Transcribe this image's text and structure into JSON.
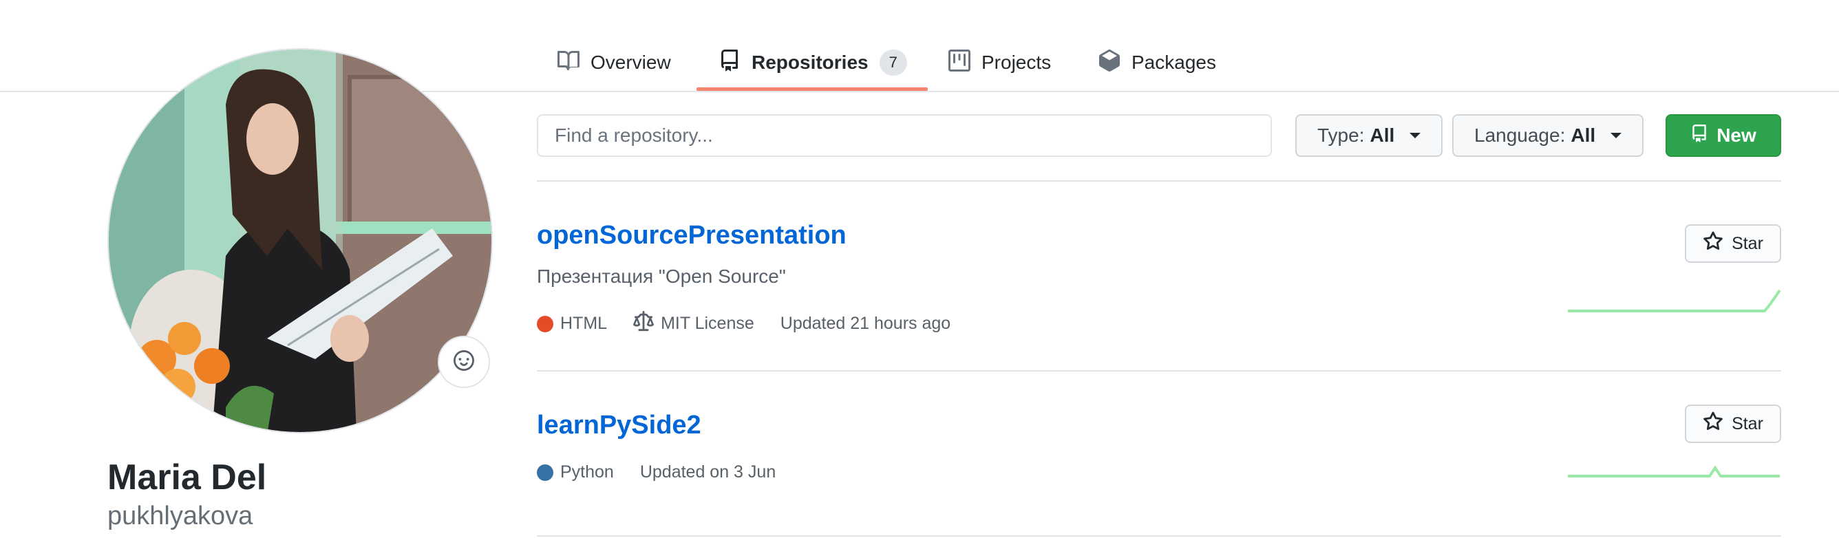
{
  "nav": {
    "tabs": [
      {
        "label": "Overview",
        "icon": "book-icon"
      },
      {
        "label": "Repositories",
        "icon": "repo-icon",
        "count": "7",
        "selected": true
      },
      {
        "label": "Projects",
        "icon": "project-icon"
      },
      {
        "label": "Packages",
        "icon": "package-icon"
      }
    ]
  },
  "profile": {
    "name": "Maria Del",
    "login": "pukhlyakova"
  },
  "filters": {
    "search_placeholder": "Find a repository...",
    "type_label": "Type:",
    "type_value": "All",
    "language_label": "Language:",
    "language_value": "All",
    "new_label": "New"
  },
  "repos": [
    {
      "name": "openSourcePresentation",
      "description": "Презентация \"Open Source\"",
      "language": "HTML",
      "language_color": "#e34c26",
      "license": "MIT License",
      "updated": "Updated 21 hours ago",
      "star_label": "Star"
    },
    {
      "name": "learnPySide2",
      "language": "Python",
      "language_color": "#3572A5",
      "updated": "Updated on 3 Jun",
      "star_label": "Star"
    }
  ],
  "colors": {
    "accent_underline": "#f9826c",
    "link": "#0366d6",
    "new_button": "#2ea44f",
    "sparkline": "#9be9a8"
  }
}
